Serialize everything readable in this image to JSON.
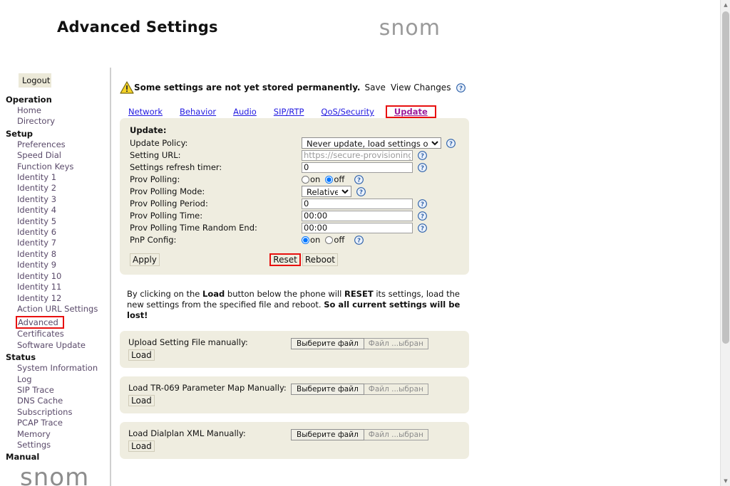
{
  "header": {
    "title": "Advanced Settings",
    "brand": "snom"
  },
  "sidebar": {
    "logout_label": "Logout",
    "footer_brand": "snom",
    "groups": [
      {
        "label": "Operation",
        "items": [
          {
            "label": "Home",
            "highlighted": false
          },
          {
            "label": "Directory",
            "highlighted": false
          }
        ]
      },
      {
        "label": "Setup",
        "items": [
          {
            "label": "Preferences",
            "highlighted": false
          },
          {
            "label": "Speed Dial",
            "highlighted": false
          },
          {
            "label": "Function Keys",
            "highlighted": false
          },
          {
            "label": "Identity 1",
            "highlighted": false
          },
          {
            "label": "Identity 2",
            "highlighted": false
          },
          {
            "label": "Identity 3",
            "highlighted": false
          },
          {
            "label": "Identity 4",
            "highlighted": false
          },
          {
            "label": "Identity 5",
            "highlighted": false
          },
          {
            "label": "Identity 6",
            "highlighted": false
          },
          {
            "label": "Identity 7",
            "highlighted": false
          },
          {
            "label": "Identity 8",
            "highlighted": false
          },
          {
            "label": "Identity 9",
            "highlighted": false
          },
          {
            "label": "Identity 10",
            "highlighted": false
          },
          {
            "label": "Identity 11",
            "highlighted": false
          },
          {
            "label": "Identity 12",
            "highlighted": false
          },
          {
            "label": "Action URL Settings",
            "highlighted": false
          },
          {
            "label": "Advanced",
            "highlighted": true
          },
          {
            "label": "Certificates",
            "highlighted": false
          },
          {
            "label": "Software Update",
            "highlighted": false
          }
        ]
      },
      {
        "label": "Status",
        "items": [
          {
            "label": "System Information",
            "highlighted": false
          },
          {
            "label": "Log",
            "highlighted": false
          },
          {
            "label": "SIP Trace",
            "highlighted": false
          },
          {
            "label": "DNS Cache",
            "highlighted": false
          },
          {
            "label": "Subscriptions",
            "highlighted": false
          },
          {
            "label": "PCAP Trace",
            "highlighted": false
          },
          {
            "label": "Memory",
            "highlighted": false
          },
          {
            "label": "Settings",
            "highlighted": false
          }
        ]
      },
      {
        "label": "Manual",
        "items": []
      }
    ]
  },
  "notice": {
    "icon": "warning-triangle-icon",
    "text": "Some settings are not yet stored permanently.",
    "save_label": "Save",
    "view_changes_label": "View Changes",
    "help_icon": "help-icon"
  },
  "tabs": [
    {
      "label": "Network",
      "active": false,
      "highlighted": false
    },
    {
      "label": "Behavior",
      "active": false,
      "highlighted": false
    },
    {
      "label": "Audio",
      "active": false,
      "highlighted": false
    },
    {
      "label": "SIP/RTP",
      "active": false,
      "highlighted": false
    },
    {
      "label": "QoS/Security",
      "active": false,
      "highlighted": false
    },
    {
      "label": "Update",
      "active": true,
      "highlighted": true
    }
  ],
  "update_panel": {
    "title": "Update:",
    "rows": [
      {
        "label": "Update Policy:",
        "type": "select",
        "value": "Never update, load settings only",
        "options": [
          "Never update, load settings only"
        ],
        "width": "wide",
        "name": "update-policy"
      },
      {
        "label": "Setting URL:",
        "type": "text",
        "value": "",
        "placeholder": "https://secure-provisioning.snom",
        "name": "setting-url"
      },
      {
        "label": "Settings refresh timer:",
        "type": "text",
        "value": "0",
        "placeholder": "",
        "name": "settings-refresh-timer"
      },
      {
        "label": "Prov Polling:",
        "type": "radio",
        "on_label": "on",
        "off_label": "off",
        "selected": "off",
        "name": "prov-polling"
      },
      {
        "label": "Prov Polling Mode:",
        "type": "select",
        "value": "Relative",
        "options": [
          "Relative"
        ],
        "width": "narrow",
        "name": "prov-polling-mode"
      },
      {
        "label": "Prov Polling Period:",
        "type": "text",
        "value": "0",
        "placeholder": "",
        "name": "prov-polling-period"
      },
      {
        "label": "Prov Polling Time:",
        "type": "text",
        "value": "00:00",
        "placeholder": "",
        "name": "prov-polling-time"
      },
      {
        "label": "Prov Polling Time Random End:",
        "type": "text",
        "value": "00:00",
        "placeholder": "",
        "name": "prov-polling-time-random-end"
      },
      {
        "label": "PnP Config:",
        "type": "radio",
        "on_label": "on",
        "off_label": "off",
        "selected": "on",
        "name": "pnp-config"
      }
    ],
    "apply_label": "Apply",
    "reset_label": "Reset",
    "reboot_label": "Reboot"
  },
  "warning_paragraph": {
    "part1": "By clicking on the ",
    "bold1": "Load",
    "part2": " button below the phone will ",
    "bold2": "RESET",
    "part3": " its settings, load the new settings from the specified file and reboot. ",
    "bold3": "So all current settings will be lost!"
  },
  "upload_panels": [
    {
      "label": "Upload Setting File manually:",
      "load_label": "Load",
      "file_button_label": "Выберите файл",
      "file_status_label": "Файл ...ыбран",
      "name": "upload-setting-file"
    },
    {
      "label": "Load TR-069 Parameter Map Manually:",
      "load_label": "Load",
      "file_button_label": "Выберите файл",
      "file_status_label": "Файл ...ыбран",
      "name": "load-tr069-parameter-map"
    },
    {
      "label": "Load Dialplan XML Manually:",
      "load_label": "Load",
      "file_button_label": "Выберите файл",
      "file_status_label": "Файл ...ыбран",
      "name": "load-dialplan-xml"
    }
  ],
  "scrollbar": {
    "up_arrow": "▲",
    "down_arrow": "▼"
  },
  "colors": {
    "panel_bg": "#efede0",
    "highlight_red": "#e8100f",
    "link_blue": "#2119e0",
    "link_visited": "#9b1b9b",
    "nav_link": "#5a4a6a"
  }
}
